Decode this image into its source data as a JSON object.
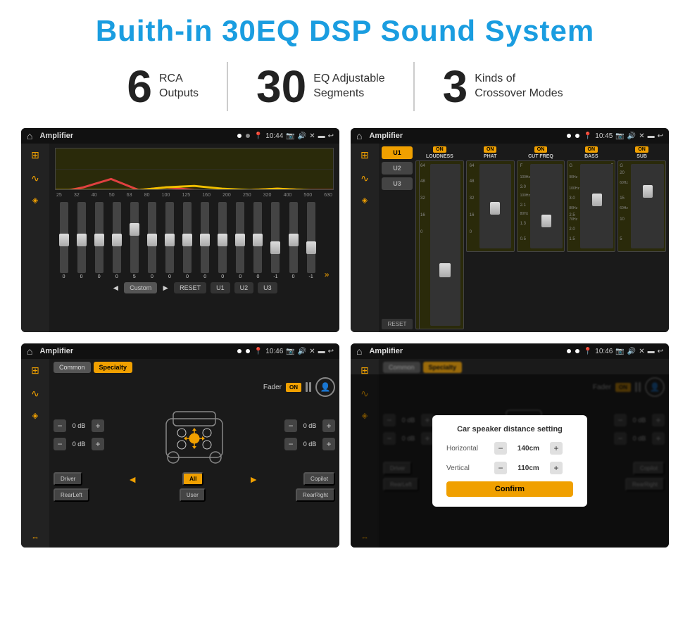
{
  "page": {
    "title": "Buith-in 30EQ DSP Sound System",
    "stats": [
      {
        "number": "6",
        "label": "RCA\nOutputs"
      },
      {
        "number": "30",
        "label": "EQ Adjustable\nSegments"
      },
      {
        "number": "3",
        "label": "Kinds of\nCrossover Modes"
      }
    ],
    "screenshots": [
      {
        "id": "eq1",
        "statusbar": {
          "title": "Amplifier",
          "time": "10:44"
        },
        "type": "eq"
      },
      {
        "id": "amp2",
        "statusbar": {
          "title": "Amplifier",
          "time": "10:45"
        },
        "type": "amp2"
      },
      {
        "id": "fader1",
        "statusbar": {
          "title": "Amplifier",
          "time": "10:46"
        },
        "type": "fader"
      },
      {
        "id": "fader2",
        "statusbar": {
          "title": "Amplifier",
          "time": "10:46"
        },
        "type": "fader-dialog"
      }
    ],
    "eq": {
      "frequencies": [
        "25",
        "32",
        "40",
        "50",
        "63",
        "80",
        "100",
        "125",
        "160",
        "200",
        "250",
        "320",
        "400",
        "500",
        "630"
      ],
      "sliders": [
        0,
        0,
        0,
        0,
        5,
        0,
        0,
        0,
        0,
        0,
        0,
        0,
        -1,
        0,
        -1
      ],
      "buttons": [
        "Custom",
        "RESET",
        "U1",
        "U2",
        "U3"
      ]
    },
    "amp2": {
      "presets": [
        "U1",
        "U2",
        "U3"
      ],
      "channels": [
        {
          "label": "LOUDNESS",
          "on": true,
          "ticks": [
            "64",
            "48",
            "32",
            "16",
            "0"
          ]
        },
        {
          "label": "PHAT",
          "on": true,
          "ticks": [
            "64",
            "48",
            "32",
            "16",
            "0"
          ]
        },
        {
          "label": "CUT FREQ",
          "on": true,
          "ticks": [
            "F",
            "",
            "",
            "",
            ""
          ]
        },
        {
          "label": "BASS",
          "on": true,
          "ticks": [
            "G",
            "",
            "F",
            "",
            "G"
          ]
        },
        {
          "label": "SUB",
          "on": true,
          "ticks": [
            "G",
            "",
            "",
            "",
            "20"
          ]
        }
      ]
    },
    "fader": {
      "tabs": [
        "Common",
        "Specialty"
      ],
      "activeTab": "Specialty",
      "faderLabel": "Fader",
      "faderOn": "ON",
      "dbValues": [
        "0 dB",
        "0 dB",
        "0 dB",
        "0 dB"
      ],
      "buttons": [
        "Driver",
        "RearLeft",
        "All",
        "User",
        "Copilot",
        "RearRight"
      ]
    },
    "dialog": {
      "title": "Car speaker distance setting",
      "rows": [
        {
          "label": "Horizontal",
          "value": "140cm"
        },
        {
          "label": "Vertical",
          "value": "110cm"
        }
      ],
      "confirmLabel": "Confirm"
    }
  }
}
